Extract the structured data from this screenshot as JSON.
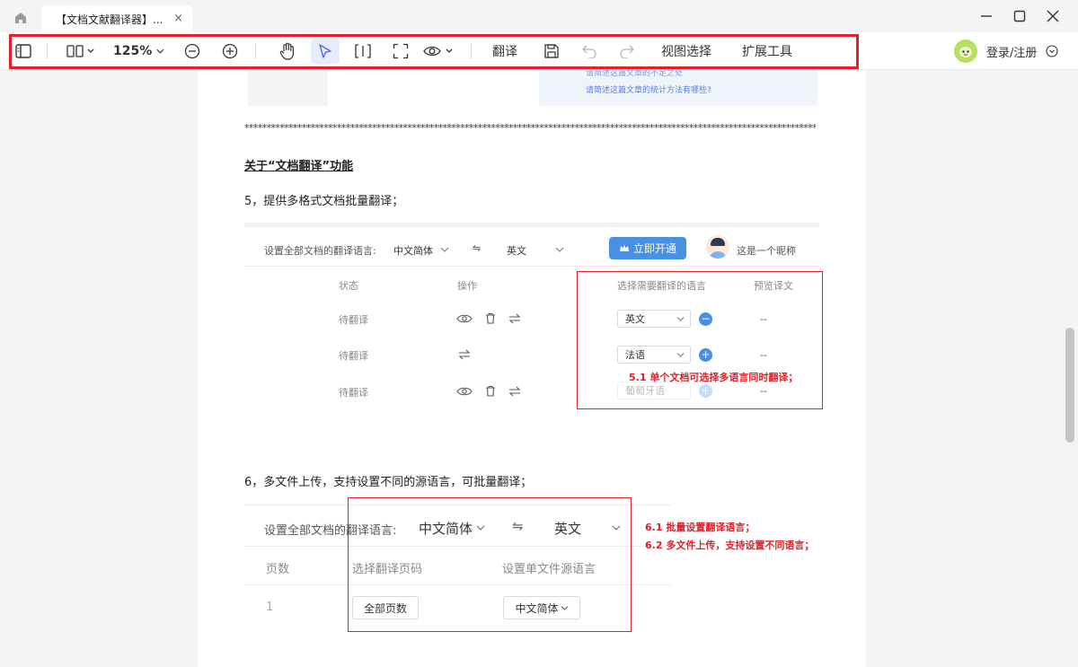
{
  "tab": {
    "title": "【文档文献翻译器】...",
    "close": "×"
  },
  "toolbar": {
    "zoom": "125%",
    "translate_label": "翻译",
    "view_select_label": "视图选择",
    "extensions_label": "扩展工具"
  },
  "account": {
    "login_label": "登录/注册"
  },
  "document": {
    "top_link_partial": "请简述这篇文章的不足之处",
    "top_link": "请简述这篇文章的统计方法有哪些?",
    "separator": "****************************************************************************************************************************************************",
    "section_title": "关于“文档翻译”功能",
    "item5": "5，提供多格式文档批量翻译；",
    "item6": "6，多文件上传，支持设置不同的源语言，可批量翻译；",
    "shot1": {
      "set_all_label": "设置全部文档的翻译语言:",
      "source_lang": "中文简体",
      "swap_icon": "⇋",
      "target_lang": "英文",
      "vip_button": "立即开通",
      "nickname": "这是一个昵称",
      "col_status": "状态",
      "col_action": "操作",
      "col_select_lang": "选择需要翻译的语言",
      "col_preview": "预览译文",
      "rows": [
        {
          "status": "待翻译",
          "lang": "英文",
          "preview": "--"
        },
        {
          "status": "待翻译",
          "lang": "法语",
          "preview": "--"
        },
        {
          "status": "待翻译",
          "lang": "葡萄牙语",
          "preview": "--"
        }
      ],
      "note": "5.1  单个文档可选择多语言同时翻译；"
    },
    "shot2": {
      "set_all_label": "设置全部文档的翻译语言:",
      "source_lang": "中文简体",
      "swap_icon": "⇋",
      "target_lang": "英文",
      "col_pages": "页数",
      "col_select_pages": "选择翻译页码",
      "col_source_lang": "设置单文件源语言",
      "row_page": "1",
      "all_pages_button": "全部页数",
      "row_source_lang": "中文简体",
      "note1": "6.1  批量设置翻译语言；",
      "note2": "6.2  多文件上传，支持设置不同语言；"
    }
  }
}
